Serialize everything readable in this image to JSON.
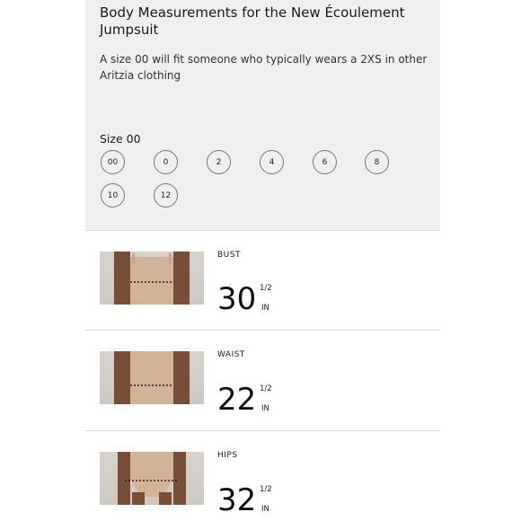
{
  "header": {
    "title": "Body Measurements for the New Écoulement Jumpsuit",
    "description": "A size 00 will fit someone who typically wears a 2XS in other Aritzia clothing"
  },
  "size_selector": {
    "label": "Size 00",
    "selected": "00",
    "options": [
      "00",
      "0",
      "2",
      "4",
      "6",
      "8",
      "10",
      "12"
    ]
  },
  "measurements": [
    {
      "label": "BUST",
      "value": "30",
      "fraction": "1/2",
      "unit": "IN"
    },
    {
      "label": "WAIST",
      "value": "22",
      "fraction": "1/2",
      "unit": "IN"
    },
    {
      "label": "HIPS",
      "value": "32",
      "fraction": "1/2",
      "unit": "IN"
    }
  ],
  "colors": {
    "panel_background": "#efefef",
    "text": "#1a1a1a",
    "divider": "#d8d8d8"
  }
}
